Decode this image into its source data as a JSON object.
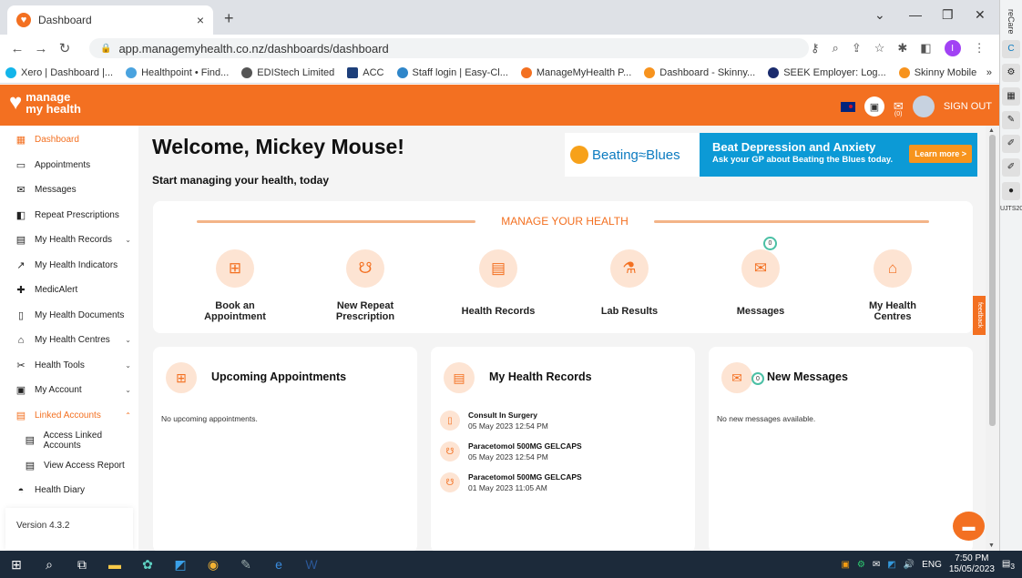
{
  "browser": {
    "tab_title": "Dashboard",
    "url": "app.managemyhealth.co.nz/dashboards/dashboard",
    "bookmarks": [
      "Xero | Dashboard |...",
      "Healthpoint • Find...",
      "EDIStech Limited",
      "ACC",
      "Staff login | Easy-Cl...",
      "ManageMyHealth P...",
      "Dashboard - Skinny...",
      "SEEK Employer: Log...",
      "Skinny Mobile"
    ],
    "more_bookmarks": "»",
    "profile_initial": "I"
  },
  "side_panel": {
    "label": "reCare",
    "bottom_label": "UJTS20"
  },
  "header": {
    "logo_line1": "manage",
    "logo_line2": "my health",
    "mail_count": "(0)",
    "sign_out": "SIGN OUT"
  },
  "nav": {
    "items": [
      {
        "label": "Dashboard"
      },
      {
        "label": "Appointments"
      },
      {
        "label": "Messages"
      },
      {
        "label": "Repeat Prescriptions"
      },
      {
        "label": "My Health Records"
      },
      {
        "label": "My Health Indicators"
      },
      {
        "label": "MedicAlert"
      },
      {
        "label": "My Health Documents"
      },
      {
        "label": "My Health Centres"
      },
      {
        "label": "Health Tools"
      },
      {
        "label": "My Account"
      },
      {
        "label": "Linked Accounts"
      },
      {
        "label": "Access Linked Accounts"
      },
      {
        "label": "View Access Report"
      },
      {
        "label": "Health Diary"
      }
    ],
    "version": "Version 4.3.2"
  },
  "main": {
    "welcome": "Welcome, Mickey Mouse!",
    "subtitle": "Start managing your health, today"
  },
  "banner": {
    "brand": "Beating≈Blues",
    "title": "Beat Depression and Anxiety",
    "subtitle": "Ask your GP about Beating the Blues today.",
    "button": "Learn more >"
  },
  "manage": {
    "title": "MANAGE YOUR HEALTH",
    "items": [
      {
        "line1": "Book an",
        "line2": "Appointment"
      },
      {
        "line1": "New Repeat",
        "line2": "Prescription"
      },
      {
        "line1": "Health Records",
        "line2": ""
      },
      {
        "line1": "Lab Results",
        "line2": ""
      },
      {
        "line1": "Messages",
        "line2": "",
        "badge": "0"
      },
      {
        "line1": "My Health",
        "line2": "Centres"
      }
    ],
    "feedback": "feedback"
  },
  "cards": {
    "appointments": {
      "title": "Upcoming Appointments",
      "empty": "No upcoming appointments."
    },
    "records": {
      "title": "My Health Records",
      "items": [
        {
          "title": "Consult In Surgery",
          "date": "05 May 2023 12:54 PM"
        },
        {
          "title": "Paracetomol 500MG GELCAPS",
          "date": "05 May 2023 12:54 PM"
        },
        {
          "title": "Paracetomol 500MG GELCAPS",
          "date": "01 May 2023 11:05 AM"
        }
      ]
    },
    "messages": {
      "title": "New Messages",
      "badge": "0",
      "empty": "No new messages available."
    }
  },
  "taskbar": {
    "lang": "ENG",
    "time": "7:50 PM",
    "date": "15/05/2023",
    "notif_count": "3"
  }
}
